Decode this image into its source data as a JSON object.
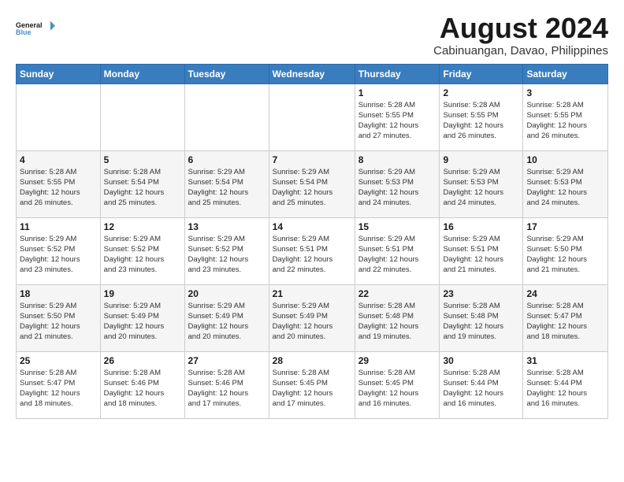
{
  "logo": {
    "line1": "General",
    "line2": "Blue"
  },
  "header": {
    "month_year": "August 2024",
    "location": "Cabinuangan, Davao, Philippines"
  },
  "weekdays": [
    "Sunday",
    "Monday",
    "Tuesday",
    "Wednesday",
    "Thursday",
    "Friday",
    "Saturday"
  ],
  "weeks": [
    [
      {
        "day": "",
        "info": ""
      },
      {
        "day": "",
        "info": ""
      },
      {
        "day": "",
        "info": ""
      },
      {
        "day": "",
        "info": ""
      },
      {
        "day": "1",
        "info": "Sunrise: 5:28 AM\nSunset: 5:55 PM\nDaylight: 12 hours\nand 27 minutes."
      },
      {
        "day": "2",
        "info": "Sunrise: 5:28 AM\nSunset: 5:55 PM\nDaylight: 12 hours\nand 26 minutes."
      },
      {
        "day": "3",
        "info": "Sunrise: 5:28 AM\nSunset: 5:55 PM\nDaylight: 12 hours\nand 26 minutes."
      }
    ],
    [
      {
        "day": "4",
        "info": "Sunrise: 5:28 AM\nSunset: 5:55 PM\nDaylight: 12 hours\nand 26 minutes."
      },
      {
        "day": "5",
        "info": "Sunrise: 5:28 AM\nSunset: 5:54 PM\nDaylight: 12 hours\nand 25 minutes."
      },
      {
        "day": "6",
        "info": "Sunrise: 5:29 AM\nSunset: 5:54 PM\nDaylight: 12 hours\nand 25 minutes."
      },
      {
        "day": "7",
        "info": "Sunrise: 5:29 AM\nSunset: 5:54 PM\nDaylight: 12 hours\nand 25 minutes."
      },
      {
        "day": "8",
        "info": "Sunrise: 5:29 AM\nSunset: 5:53 PM\nDaylight: 12 hours\nand 24 minutes."
      },
      {
        "day": "9",
        "info": "Sunrise: 5:29 AM\nSunset: 5:53 PM\nDaylight: 12 hours\nand 24 minutes."
      },
      {
        "day": "10",
        "info": "Sunrise: 5:29 AM\nSunset: 5:53 PM\nDaylight: 12 hours\nand 24 minutes."
      }
    ],
    [
      {
        "day": "11",
        "info": "Sunrise: 5:29 AM\nSunset: 5:52 PM\nDaylight: 12 hours\nand 23 minutes."
      },
      {
        "day": "12",
        "info": "Sunrise: 5:29 AM\nSunset: 5:52 PM\nDaylight: 12 hours\nand 23 minutes."
      },
      {
        "day": "13",
        "info": "Sunrise: 5:29 AM\nSunset: 5:52 PM\nDaylight: 12 hours\nand 23 minutes."
      },
      {
        "day": "14",
        "info": "Sunrise: 5:29 AM\nSunset: 5:51 PM\nDaylight: 12 hours\nand 22 minutes."
      },
      {
        "day": "15",
        "info": "Sunrise: 5:29 AM\nSunset: 5:51 PM\nDaylight: 12 hours\nand 22 minutes."
      },
      {
        "day": "16",
        "info": "Sunrise: 5:29 AM\nSunset: 5:51 PM\nDaylight: 12 hours\nand 21 minutes."
      },
      {
        "day": "17",
        "info": "Sunrise: 5:29 AM\nSunset: 5:50 PM\nDaylight: 12 hours\nand 21 minutes."
      }
    ],
    [
      {
        "day": "18",
        "info": "Sunrise: 5:29 AM\nSunset: 5:50 PM\nDaylight: 12 hours\nand 21 minutes."
      },
      {
        "day": "19",
        "info": "Sunrise: 5:29 AM\nSunset: 5:49 PM\nDaylight: 12 hours\nand 20 minutes."
      },
      {
        "day": "20",
        "info": "Sunrise: 5:29 AM\nSunset: 5:49 PM\nDaylight: 12 hours\nand 20 minutes."
      },
      {
        "day": "21",
        "info": "Sunrise: 5:29 AM\nSunset: 5:49 PM\nDaylight: 12 hours\nand 20 minutes."
      },
      {
        "day": "22",
        "info": "Sunrise: 5:28 AM\nSunset: 5:48 PM\nDaylight: 12 hours\nand 19 minutes."
      },
      {
        "day": "23",
        "info": "Sunrise: 5:28 AM\nSunset: 5:48 PM\nDaylight: 12 hours\nand 19 minutes."
      },
      {
        "day": "24",
        "info": "Sunrise: 5:28 AM\nSunset: 5:47 PM\nDaylight: 12 hours\nand 18 minutes."
      }
    ],
    [
      {
        "day": "25",
        "info": "Sunrise: 5:28 AM\nSunset: 5:47 PM\nDaylight: 12 hours\nand 18 minutes."
      },
      {
        "day": "26",
        "info": "Sunrise: 5:28 AM\nSunset: 5:46 PM\nDaylight: 12 hours\nand 18 minutes."
      },
      {
        "day": "27",
        "info": "Sunrise: 5:28 AM\nSunset: 5:46 PM\nDaylight: 12 hours\nand 17 minutes."
      },
      {
        "day": "28",
        "info": "Sunrise: 5:28 AM\nSunset: 5:45 PM\nDaylight: 12 hours\nand 17 minutes."
      },
      {
        "day": "29",
        "info": "Sunrise: 5:28 AM\nSunset: 5:45 PM\nDaylight: 12 hours\nand 16 minutes."
      },
      {
        "day": "30",
        "info": "Sunrise: 5:28 AM\nSunset: 5:44 PM\nDaylight: 12 hours\nand 16 minutes."
      },
      {
        "day": "31",
        "info": "Sunrise: 5:28 AM\nSunset: 5:44 PM\nDaylight: 12 hours\nand 16 minutes."
      }
    ]
  ]
}
